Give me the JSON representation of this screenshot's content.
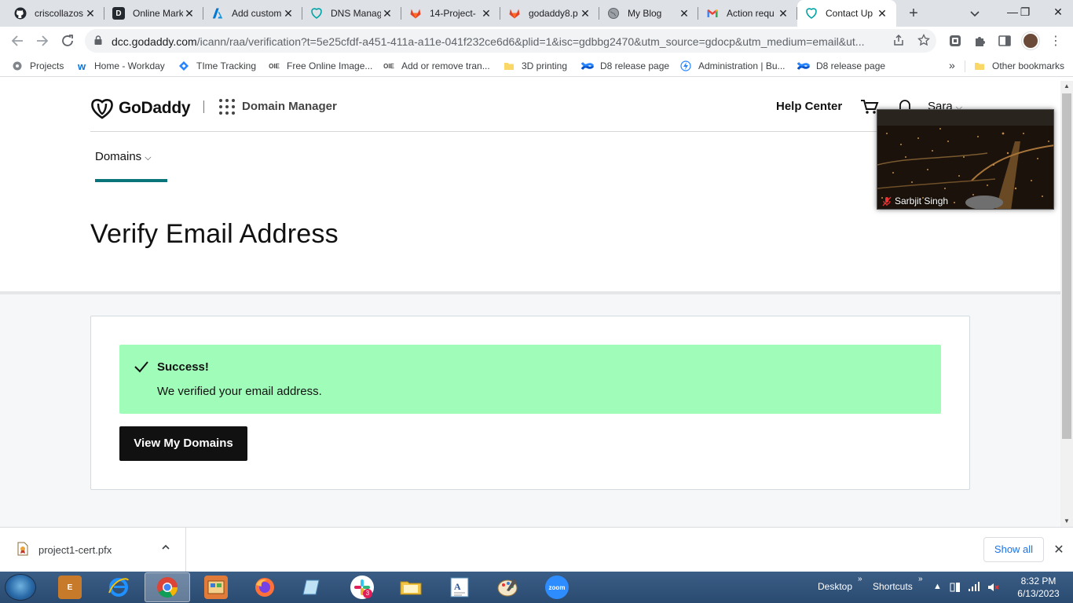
{
  "tabs": [
    {
      "title": "criscollazos",
      "icon": "github-icon",
      "color": "#24292f",
      "glyph": ""
    },
    {
      "title": "Online Mark",
      "icon": "d-app-icon",
      "color": "#24292f",
      "glyph": "D"
    },
    {
      "title": "Add custom",
      "icon": "azure-icon",
      "color": "#0078d4",
      "glyph": "A"
    },
    {
      "title": "DNS Manag",
      "icon": "godaddy-icon",
      "color": "#00a4a6",
      "glyph": ""
    },
    {
      "title": "14-Project-",
      "icon": "gitlab-icon",
      "color": "#e24329",
      "glyph": ""
    },
    {
      "title": "godaddy8.p",
      "icon": "gitlab-icon",
      "color": "#e24329",
      "glyph": ""
    },
    {
      "title": "My Blog",
      "icon": "globe-icon",
      "color": "#5f6368",
      "glyph": ""
    },
    {
      "title": "Action requ",
      "icon": "gmail-icon",
      "color": "#ea4335",
      "glyph": "M"
    },
    {
      "title": "Contact Up",
      "icon": "godaddy-icon",
      "color": "#00a4a6",
      "glyph": ""
    }
  ],
  "address_bar": {
    "host": "dcc.godaddy.com",
    "path": "/icann/raa/verification?t=5e25cfdf-a451-411a-a11e-041f232ce6d6&plid=1&isc=gdbbg2470&utm_source=gdocp&utm_medium=email&ut..."
  },
  "bookmarks": [
    {
      "label": "Projects",
      "icon": "gear-icon"
    },
    {
      "label": "Home - Workday",
      "icon": "workday-icon"
    },
    {
      "label": "TIme Tracking",
      "icon": "jira-icon"
    },
    {
      "label": "Free Online Image...",
      "icon": "oie-icon"
    },
    {
      "label": "Add or remove tran...",
      "icon": "oie-icon"
    },
    {
      "label": "3D printing",
      "icon": "folder-icon"
    },
    {
      "label": "D8 release page",
      "icon": "confluence-icon"
    },
    {
      "label": "Administration | Bu...",
      "icon": "bolt-icon"
    },
    {
      "label": "D8 release page",
      "icon": "confluence-icon"
    }
  ],
  "bookmarks_other": "Other bookmarks",
  "godaddy": {
    "logo": "GoDaddy",
    "product": "Domain Manager",
    "help": "Help Center",
    "user": "Sara",
    "nav_domains": "Domains",
    "page_title": "Verify Email Address",
    "alert_title": "Success!",
    "alert_message": "We verified your email address.",
    "button": "View My Domains",
    "success_color": "#a0fcb9"
  },
  "zoom_video": {
    "participant": "Sarbjit Singh"
  },
  "downloads": {
    "file": "project1-cert.pfx",
    "show_all": "Show all"
  },
  "taskbar": {
    "desktop": "Desktop",
    "shortcuts": "Shortcuts",
    "time": "8:32 PM",
    "date": "6/13/2023",
    "slack_badge": "3",
    "zoom_label": "zoom"
  }
}
